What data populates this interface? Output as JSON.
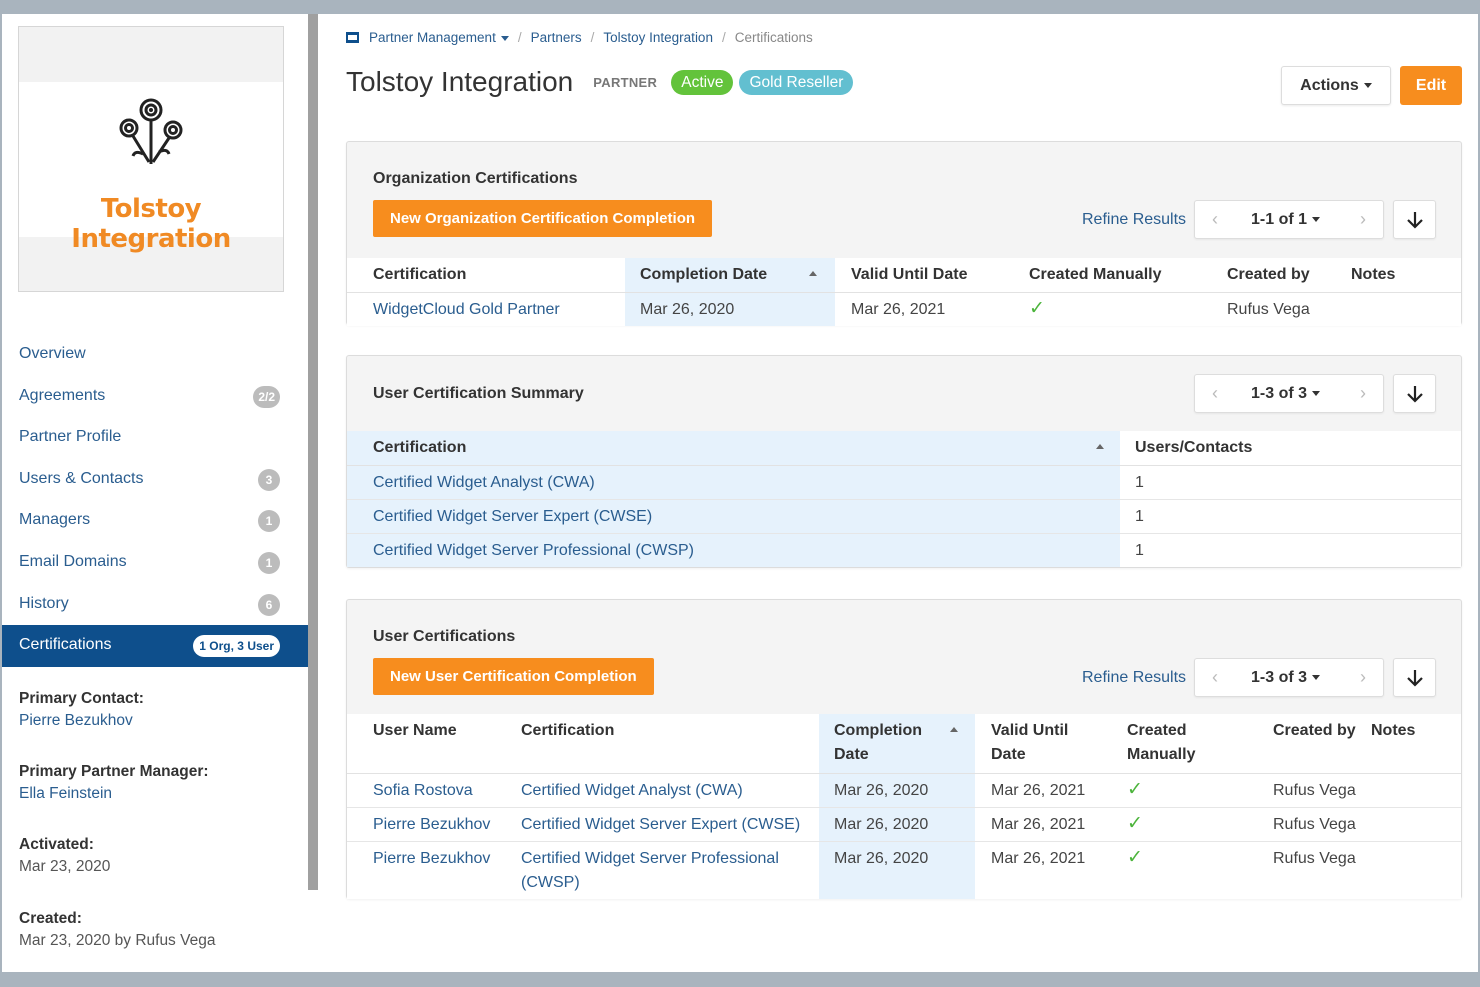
{
  "sidebar": {
    "logo_text": "Tolstoy Integration",
    "nav": [
      {
        "label": "Overview",
        "badge": ""
      },
      {
        "label": "Agreements",
        "badge": "2/2"
      },
      {
        "label": "Partner Profile",
        "badge": ""
      },
      {
        "label": "Users & Contacts",
        "badge": "3"
      },
      {
        "label": "Managers",
        "badge": "1"
      },
      {
        "label": "Email Domains",
        "badge": "1"
      },
      {
        "label": "History",
        "badge": "6"
      },
      {
        "label": "Certifications",
        "badge": "1 Org, 3 User"
      }
    ],
    "meta": [
      {
        "label": "Primary Contact:",
        "value": "Pierre Bezukhov"
      },
      {
        "label": "Primary Partner Manager:",
        "value": "Ella Feinstein"
      },
      {
        "label": "Activated:",
        "value": "Mar 23, 2020"
      },
      {
        "label": "Created:",
        "value": "Mar 23, 2020 by Rufus Vega"
      }
    ]
  },
  "breadcrumb": {
    "root": "Partner Management",
    "partners": "Partners",
    "partner": "Tolstoy Integration",
    "current": "Certifications"
  },
  "header": {
    "title": "Tolstoy Integration",
    "type": "PARTNER",
    "status": "Active",
    "tier": "Gold Reseller",
    "actions_label": "Actions",
    "edit_label": "Edit"
  },
  "org_certs": {
    "title": "Organization Certifications",
    "new_button": "New Organization Certification Completion",
    "refine": "Refine Results",
    "range": "1-1 of 1",
    "columns": [
      "Certification",
      "Completion Date",
      "Valid Until Date",
      "Created Manually",
      "Created by",
      "Notes"
    ],
    "rows": [
      [
        "WidgetCloud Gold Partner",
        "Mar 26, 2020",
        "Mar 26, 2021",
        "✓",
        "Rufus Vega",
        ""
      ]
    ]
  },
  "summary": {
    "title": "User Certification Summary",
    "range": "1-3 of 3",
    "columns": [
      "Certification",
      "Users/Contacts"
    ],
    "rows": [
      [
        "Certified Widget Analyst (CWA)",
        "1"
      ],
      [
        "Certified Widget Server Expert (CWSE)",
        "1"
      ],
      [
        "Certified Widget Server Professional (CWSP)",
        "1"
      ]
    ]
  },
  "user_certs": {
    "title": "User Certifications",
    "new_button": "New User Certification Completion",
    "refine": "Refine Results",
    "range": "1-3 of 3",
    "columns": [
      "User Name",
      "Certification",
      "Completion Date",
      "Valid Until Date",
      "Created Manually",
      "Created by",
      "Notes"
    ],
    "rows": [
      [
        "Sofia Rostova",
        "Certified Widget Analyst (CWA)",
        "Mar 26, 2020",
        "Mar 26, 2021",
        "✓",
        "Rufus Vega",
        ""
      ],
      [
        "Pierre Bezukhov",
        "Certified Widget Server Expert (CWSE)",
        "Mar 26, 2020",
        "Mar 26, 2021",
        "✓",
        "Rufus Vega",
        ""
      ],
      [
        "Pierre Bezukhov",
        "Certified Widget Server Professional (CWSP)",
        "Mar 26, 2020",
        "Mar 26, 2021",
        "✓",
        "Rufus Vega",
        ""
      ]
    ]
  },
  "icons": {
    "prev": "chevron-left-icon",
    "next": "chevron-right-icon",
    "download": "download-arrow-icon",
    "check": "checkmark-icon",
    "breadcrumb": "partner-icon"
  },
  "colors": {
    "accent": "#f78d1e",
    "link": "#2a5d8f",
    "nav_active": "#0e4f8c",
    "active_pill": "#63c33b",
    "tier_pill": "#62bfd0",
    "sorted_col": "#e6f2fc"
  }
}
